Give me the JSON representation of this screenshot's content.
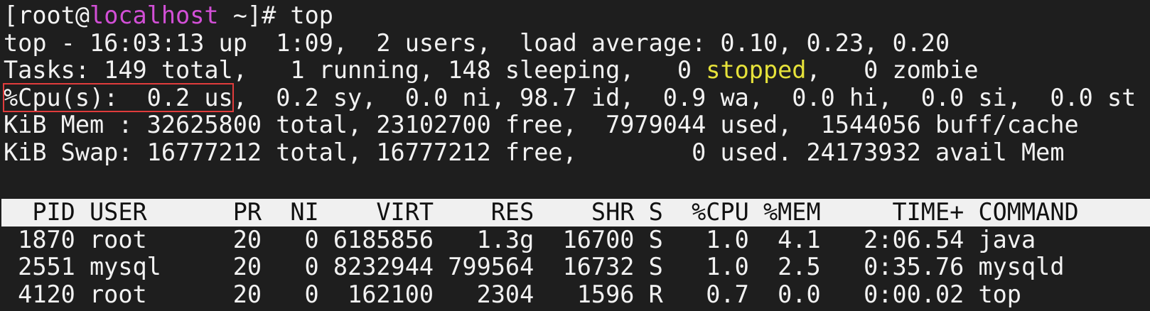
{
  "prompt": {
    "open_bracket": "[",
    "user": "root",
    "at": "@",
    "host": "localhost",
    "path_suffix": " ~]# ",
    "command": "top"
  },
  "summary": {
    "uptime_line": "top - 16:03:13 up  1:09,  2 users,  load average: 0.10, 0.23, 0.20",
    "tasks_prefix": "Tasks: 149 total,   1 running, 148 sleeping,   0 ",
    "tasks_stopped": "stopped",
    "tasks_suffix": ",   0 zombie",
    "cpu_highlight": "%Cpu(s):  0.2 us",
    "cpu_rest": ",  0.2 sy,  0.0 ni, 98.7 id,  0.9 wa,  0.0 hi,  0.0 si,  0.0 st",
    "mem_line": "KiB Mem : 32625800 total, 23102700 free,  7979044 used,  1544056 buff/cache",
    "swap_line": "KiB Swap: 16777212 total, 16777212 free,        0 used. 24173932 avail Mem"
  },
  "process_table": {
    "header": "  PID USER      PR  NI    VIRT    RES    SHR S  %CPU %MEM     TIME+ COMMAND",
    "rows": [
      " 1870 root      20   0 6185856   1.3g  16700 S   1.0  4.1   2:06.54 java",
      " 2551 mysql     20   0 8232944 799564  16732 S   1.0  2.5   0:35.76 mysqld",
      " 4120 root      20   0  162100   2304   1596 R   0.7  0.0   0:00.02 top"
    ]
  },
  "colors": {
    "background": "#1e1e1e",
    "text": "#f2f2f2",
    "hostname": "#d24fd6",
    "stopped": "#e6e23a",
    "highlight_box": "#e03c3c",
    "header_bg": "#f0f0f0"
  }
}
